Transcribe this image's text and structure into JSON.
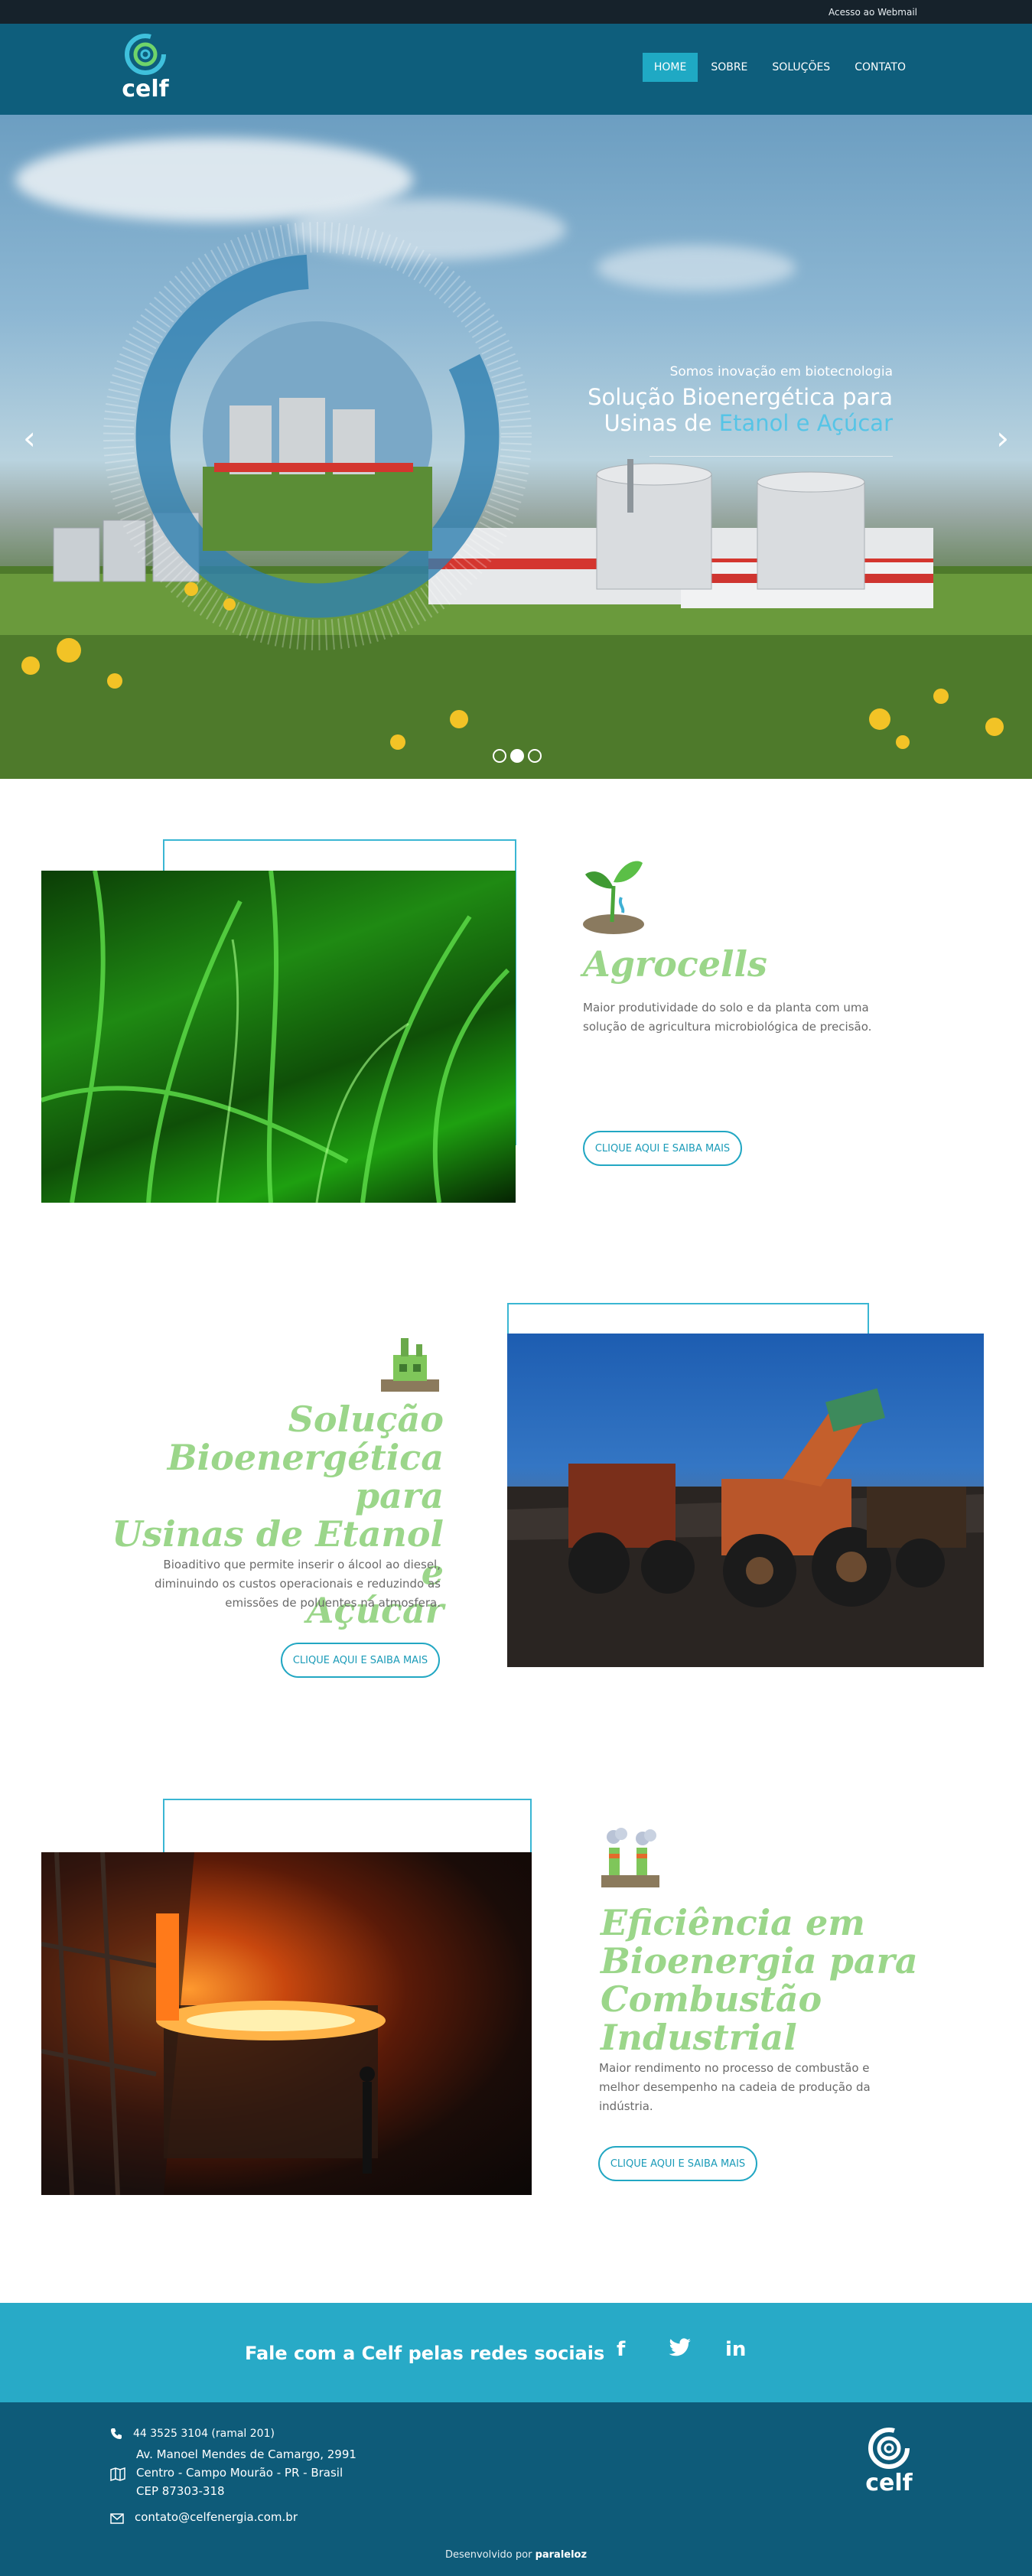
{
  "topbar": {
    "webmail": "Acesso ao Webmail"
  },
  "header": {
    "logo_text": "celf",
    "nav": [
      {
        "label": "HOME",
        "active": true
      },
      {
        "label": "SOBRE",
        "active": false
      },
      {
        "label": "SOLUÇÕES",
        "active": false
      },
      {
        "label": "CONTATO",
        "active": false
      }
    ]
  },
  "hero": {
    "kicker": "Somos inovação em biotecnologia",
    "title_line1": "Solução Bioenergética para",
    "title_line2_prefix": "Usinas de",
    "title_line2_accent": "Etanol e Açúcar",
    "prev_arrow": "‹",
    "next_arrow": "›",
    "slides": 3,
    "active_slide": 2
  },
  "features": [
    {
      "icon": "sprout-icon",
      "title": "Agrocells",
      "description": "Maior produtividade do solo e da planta com uma solução de agricultura microbiológica de precisão.",
      "button": "CLIQUE AQUI E SAIBA MAIS"
    },
    {
      "icon": "factory-icon",
      "title_lines": [
        "Solução",
        "Bioenergética para",
        "Usinas de Etanol e",
        "Açúcar"
      ],
      "description": "Bioaditivo que permite inserir o álcool ao diesel, diminuindo os custos operacionais e reduzindo as emissões de poluentes na atmosfera.",
      "button": "CLIQUE AQUI E SAIBA MAIS"
    },
    {
      "icon": "industrial-plant-icon",
      "title_lines": [
        "Eficiência em",
        "Bioenergia para",
        "Combustão",
        "Industrial"
      ],
      "description": "Maior rendimento no processo de combustão e melhor desempenho na cadeia de produção da indústria.",
      "button": "CLIQUE AQUI E SAIBA MAIS"
    }
  ],
  "social": {
    "text": "Fale com a Celf pelas redes sociais",
    "icons": [
      "facebook-icon",
      "twitter-icon",
      "linkedin-icon"
    ],
    "glyphs": [
      "f",
      "t",
      "in"
    ]
  },
  "footer": {
    "phone": "44 3525 3104 (ramal 201)",
    "address": [
      "Av. Manoel Mendes de Camargo, 2991",
      "Centro - Campo Mourão - PR - Brasil",
      "CEP 87303-318"
    ],
    "email": "contato@celfenergia.com.br",
    "logo_text": "celf",
    "credit_prefix": "Desenvolvido por",
    "credit_brand": "paraleloz"
  },
  "colors": {
    "header": "#0e5e7c",
    "accent": "#1fa9c4",
    "title_green": "#9bd68a",
    "footer": "#0e5b79",
    "social": "#28aac7"
  }
}
